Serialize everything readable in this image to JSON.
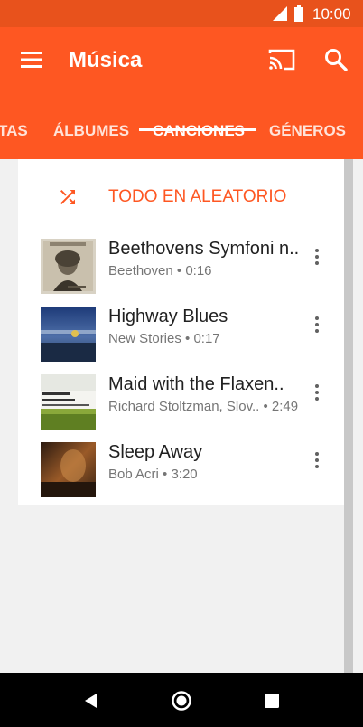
{
  "status_bar": {
    "time": "10:00",
    "icons": [
      "signal-icon",
      "battery-icon"
    ]
  },
  "app_bar": {
    "title": "Música",
    "icons": [
      "menu-icon",
      "cast-icon",
      "search-icon"
    ],
    "background_color": "#fe5722",
    "status_color": "#e8521c"
  },
  "tabs": [
    {
      "label": "TAS",
      "active": false
    },
    {
      "label": "ÁLBUMES",
      "active": false
    },
    {
      "label": "CANCIONES",
      "active": true
    },
    {
      "label": "GÉNEROS",
      "active": false
    }
  ],
  "shuffle": {
    "label": "TODO EN ALEATORIO",
    "icon": "shuffle-icon"
  },
  "songs": [
    {
      "title": "Beethovens Symfoni n..",
      "subtitle": "Beethoven • 0:16",
      "art": "beethoven-album-art"
    },
    {
      "title": "Highway Blues",
      "subtitle": "New Stories • 0:17",
      "art": "highway-blues-album-art"
    },
    {
      "title": "Maid with the Flaxen..",
      "subtitle": "Richard Stoltzman, Slov..  • 2:49",
      "art": "richard-stoltzman-album-art"
    },
    {
      "title": "Sleep Away",
      "subtitle": "Bob Acri • 3:20",
      "art": "sleep-away-album-art"
    }
  ],
  "nav_bar": {
    "icons": [
      "back-icon",
      "home-icon",
      "recents-icon"
    ]
  },
  "accent_color": "#fe5722"
}
